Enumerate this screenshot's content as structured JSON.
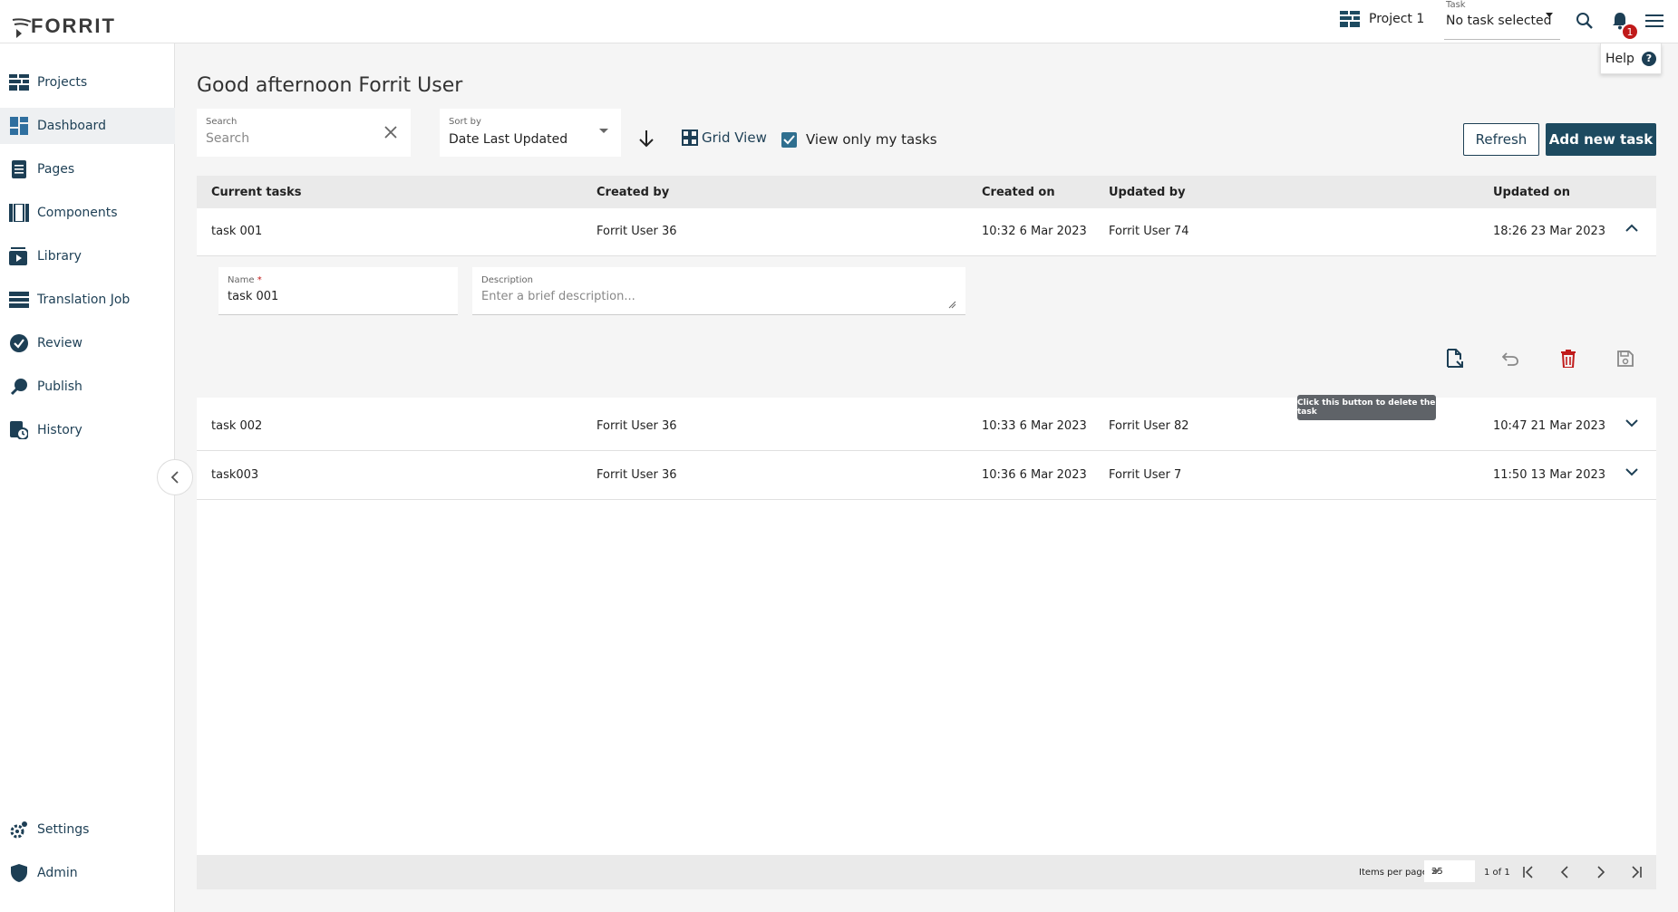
{
  "header": {
    "logo_text": "FORRIT",
    "project_label": "Project 1",
    "task_selector": {
      "label": "Task",
      "value": "No task selected"
    },
    "notification_count": "1",
    "help_label": "Help"
  },
  "sidebar": {
    "items": [
      {
        "label": "Projects",
        "icon": "projects-icon"
      },
      {
        "label": "Dashboard",
        "icon": "dashboard-icon",
        "active": true
      },
      {
        "label": "Pages",
        "icon": "pages-icon"
      },
      {
        "label": "Components",
        "icon": "components-icon"
      },
      {
        "label": "Library",
        "icon": "library-icon"
      },
      {
        "label": "Translation Job",
        "icon": "translation-job-icon"
      },
      {
        "label": "Review",
        "icon": "review-icon"
      },
      {
        "label": "Publish",
        "icon": "publish-icon"
      },
      {
        "label": "History",
        "icon": "history-icon"
      }
    ],
    "bottom_items": [
      {
        "label": "Settings",
        "icon": "settings-icon"
      },
      {
        "label": "Admin",
        "icon": "admin-icon"
      }
    ]
  },
  "main": {
    "greeting": "Good afternoon Forrit User",
    "search": {
      "label": "Search",
      "placeholder": "Search"
    },
    "sort": {
      "label": "Sort by",
      "value": "Date Last Updated"
    },
    "grid_view_label": "Grid View",
    "only_mine_label": "View only my tasks",
    "only_mine_checked": true,
    "refresh_label": "Refresh",
    "add_task_label": "Add new task"
  },
  "table": {
    "columns": [
      "Current tasks",
      "Created by",
      "Created on",
      "Updated by",
      "Updated on"
    ],
    "rows": [
      {
        "name": "task 001",
        "created_by": "Forrit User 36",
        "created_on": "10:32 6 Mar 2023",
        "updated_by": "Forrit User 74",
        "updated_on": "18:26 23 Mar 2023",
        "expanded": true
      },
      {
        "name": "task 002",
        "created_by": "Forrit User 36",
        "created_on": "10:33 6 Mar 2023",
        "updated_by": "Forrit User 82",
        "updated_on": "10:47 21 Mar 2023",
        "expanded": false
      },
      {
        "name": "task003",
        "created_by": "Forrit User 36",
        "created_on": "10:36 6 Mar 2023",
        "updated_by": "Forrit User 7",
        "updated_on": "11:50 13 Mar 2023",
        "expanded": false
      }
    ],
    "detail": {
      "name_label": "Name",
      "name_required_mark": "*",
      "name_value": "task 001",
      "description_label": "Description",
      "description_placeholder": "Enter a brief description..."
    },
    "delete_tooltip": "Click this button to delete the task"
  },
  "pagination": {
    "items_per_page_label": "Items per page",
    "items_per_page": "25",
    "page_info": "1 of 1"
  },
  "colors": {
    "primary": "#1d4a60",
    "nav_text": "#1d3f55",
    "danger": "#c01a1a",
    "checkbox": "#2f6f8f"
  }
}
